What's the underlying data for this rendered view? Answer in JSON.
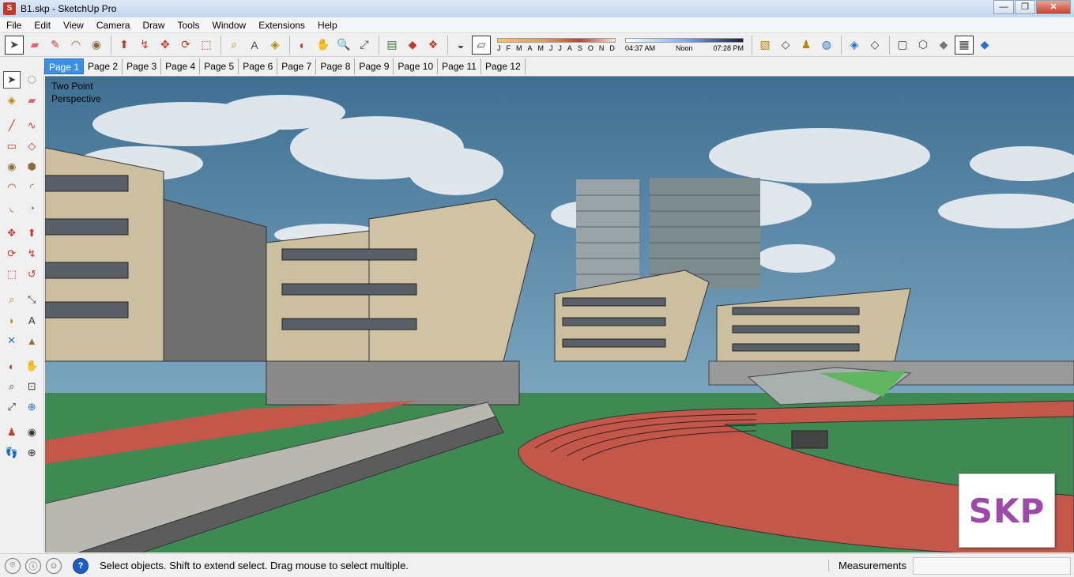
{
  "window": {
    "title": "B1.skp - SketchUp Pro",
    "min": "—",
    "max": "❐",
    "close": "✕"
  },
  "menu": [
    "File",
    "Edit",
    "View",
    "Camera",
    "Draw",
    "Tools",
    "Window",
    "Extensions",
    "Help"
  ],
  "shadow": {
    "months": [
      "J",
      "F",
      "M",
      "A",
      "M",
      "J",
      "J",
      "A",
      "S",
      "O",
      "N",
      "D"
    ],
    "sunrise": "04:37 AM",
    "noon": "Noon",
    "sunset": "07:28 PM"
  },
  "tabs": [
    "Page 1",
    "Page 2",
    "Page 3",
    "Page 4",
    "Page 5",
    "Page 6",
    "Page 7",
    "Page 8",
    "Page 9",
    "Page 10",
    "Page 11",
    "Page 12"
  ],
  "active_tab": "Page 1",
  "viewport": {
    "camera_line1": "Two Point",
    "camera_line2": "Perspective",
    "logo": "SKP"
  },
  "status": {
    "message": "Select objects. Shift to extend select. Drag mouse to select multiple.",
    "measurements_label": "Measurements",
    "help_icon": "?"
  },
  "colors": {
    "sky": "#4d7fa0",
    "grass": "#3f8a52",
    "track": "#c2574a",
    "concrete": "#cbbf9f",
    "active_tab": "#3d8fe6",
    "logo": "#9b4aa8"
  }
}
